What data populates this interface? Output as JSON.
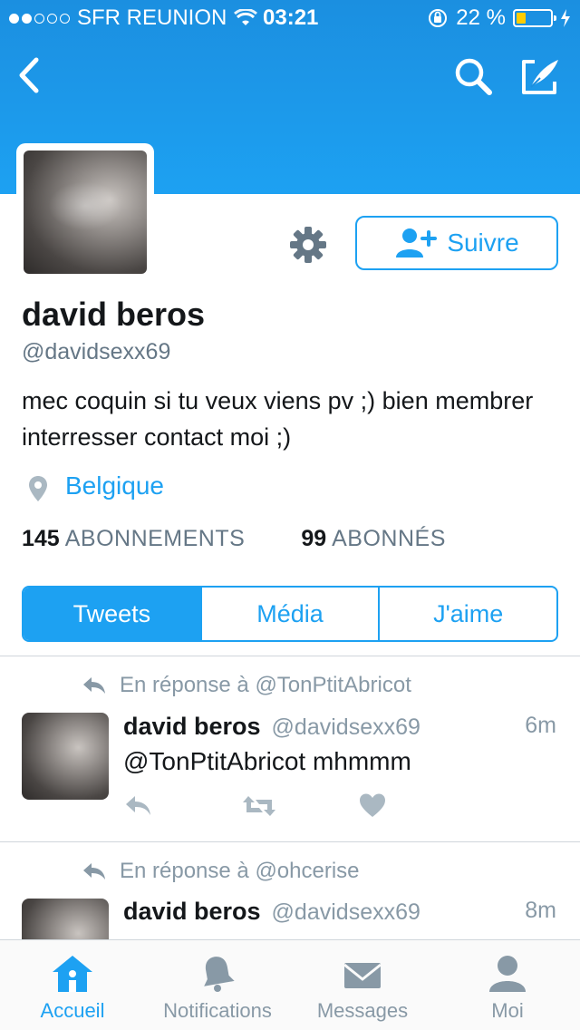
{
  "status_bar": {
    "carrier": "SFR REUNION",
    "time": "03:21",
    "battery": "22 %",
    "battery_level": 0.22
  },
  "nav": {
    "back_icon": "chevron-left-icon",
    "search_icon": "search-icon",
    "compose_icon": "compose-tweet-icon"
  },
  "profile": {
    "name": "david beros",
    "handle": "@davidsexx69",
    "bio": "mec coquin si tu veux viens pv ;) bien membrer interresser contact moi ;)",
    "location": "Belgique",
    "follow_label": "Suivre",
    "following_count": "145",
    "following_label": "ABONNEMENTS",
    "followers_count": "99",
    "followers_label": "ABONNÉS"
  },
  "tabs": [
    {
      "label": "Tweets",
      "active": true
    },
    {
      "label": "Média",
      "active": false
    },
    {
      "label": "J'aime",
      "active": false
    }
  ],
  "tweets": [
    {
      "reply_to": "En réponse à @TonPtitAbricot",
      "name": "david beros",
      "handle": "@davidsexx69",
      "time": "6m",
      "text": "@TonPtitAbricot mhmmm"
    },
    {
      "reply_to": "En réponse à @ohcerise",
      "name": "david beros",
      "handle": "@davidsexx69",
      "time": "8m",
      "text": ""
    }
  ],
  "tabbar": [
    {
      "label": "Accueil",
      "icon": "home-icon",
      "active": true
    },
    {
      "label": "Notifications",
      "icon": "bell-icon",
      "active": false
    },
    {
      "label": "Messages",
      "icon": "envelope-icon",
      "active": false
    },
    {
      "label": "Moi",
      "icon": "person-icon",
      "active": false
    }
  ],
  "colors": {
    "accent": "#1da1f2",
    "muted": "#8899a6"
  }
}
